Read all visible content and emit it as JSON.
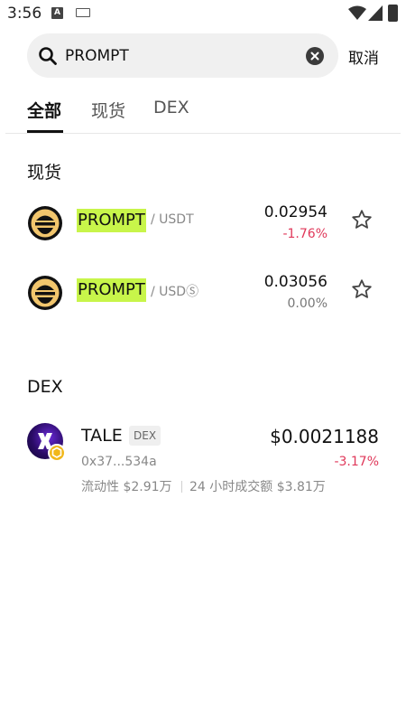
{
  "status_bar": {
    "time": "3:56",
    "icons": [
      "a-notification-icon",
      "keyboard-icon",
      "wifi-icon",
      "signal-icon",
      "battery-icon"
    ]
  },
  "search": {
    "value": "PROMPT",
    "cancel_label": "取消"
  },
  "tabs": [
    {
      "label": "全部",
      "active": true
    },
    {
      "label": "现货",
      "active": false
    },
    {
      "label": "DEX",
      "active": false
    }
  ],
  "spot": {
    "title": "现货",
    "items": [
      {
        "base": "PROMPT",
        "quote": "/ USDT",
        "price": "0.02954",
        "change": "-1.76%"
      },
      {
        "base": "PROMPT",
        "quote": "/ USDⓈ",
        "price": "0.03056",
        "change": "0.00%"
      }
    ]
  },
  "dex": {
    "title": "DEX",
    "items": [
      {
        "name": "TALE",
        "tag": "DEX",
        "price": "$0.0021188",
        "address": "0x37...534a",
        "change": "-3.17%",
        "liquidity": "流动性 $2.91万",
        "volume": "24 小时成交额 $3.81万"
      }
    ]
  },
  "colors": {
    "highlight": "#c8f54a",
    "negative": "#e0385a",
    "neutral": "#777777",
    "search_bg": "#f0f0f0"
  }
}
